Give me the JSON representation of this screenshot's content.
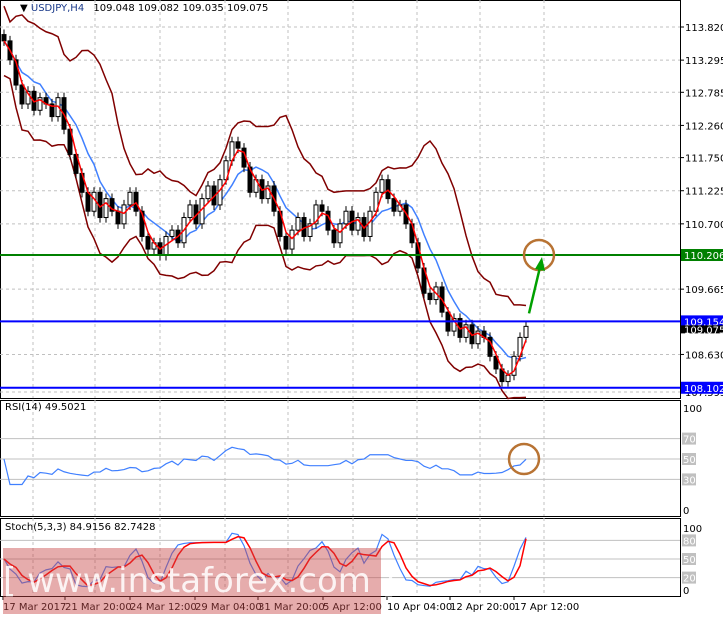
{
  "header": {
    "symbol": "USDJPY,H4",
    "ohlc": "109.048 109.082 109.035 109.075"
  },
  "rsi_label": "RSI(14) 49.5021",
  "stoch_label": "Stoch(5,3,3) 84.9156 82.7428",
  "watermark": "[ www.instaforex.com ]",
  "colors": {
    "bollinger": "#800000",
    "ma_fast": "#ff0000",
    "ma_slow": "#4080ff",
    "support": "#0000ff",
    "resistance": "#008000",
    "annotation": "#b87333",
    "arrow": "#00a000"
  },
  "chart_data": {
    "type": "candlestick",
    "price_ticks": [
      "113.820",
      "113.295",
      "112.785",
      "112.260",
      "111.750",
      "111.225",
      "110.700",
      "109.665",
      "108.630",
      "107.595"
    ],
    "price_range": [
      107.6,
      114.2
    ],
    "levels": [
      {
        "value": "110.206",
        "kind": "resistance"
      },
      {
        "value": "109.154",
        "kind": "support"
      },
      {
        "value": "108.102",
        "kind": "support"
      }
    ],
    "current_price": "109.075",
    "x_labels": [
      "17 Mar 2017",
      "21 Mar 20:00",
      "24 Mar 12:00",
      "29 Mar 04:00",
      "31 Mar 20:00",
      "5 Apr 12:00",
      "10 Apr 04:00",
      "12 Apr 20:00",
      "17 Apr 12:00"
    ],
    "closes": [
      113.6,
      113.3,
      112.9,
      112.6,
      112.8,
      112.5,
      112.7,
      112.6,
      112.4,
      112.7,
      112.2,
      111.8,
      111.5,
      111.2,
      110.9,
      111.2,
      110.8,
      111.1,
      110.9,
      110.7,
      111.0,
      111.2,
      110.9,
      110.5,
      110.3,
      110.4,
      110.2,
      110.5,
      110.6,
      110.4,
      110.8,
      111.0,
      110.7,
      111.1,
      111.3,
      111.0,
      111.4,
      111.7,
      112.0,
      111.9,
      111.6,
      111.2,
      111.4,
      111.1,
      111.3,
      110.9,
      110.5,
      110.3,
      110.6,
      110.8,
      110.5,
      110.7,
      111.0,
      110.9,
      110.6,
      110.4,
      110.7,
      110.9,
      110.6,
      110.8,
      110.5,
      110.9,
      111.2,
      111.4,
      111.1,
      110.9,
      111.0,
      110.7,
      110.4,
      110.0,
      109.6,
      109.5,
      109.7,
      109.3,
      109.0,
      109.2,
      108.9,
      109.1,
      108.8,
      109.0,
      108.9,
      108.6,
      108.4,
      108.2,
      108.3,
      108.6,
      108.9,
      109.075
    ],
    "rsi": {
      "levels": [
        70,
        50,
        30
      ],
      "range": [
        0,
        100
      ],
      "ticks": [
        "100",
        "70",
        "50",
        "30",
        "0"
      ],
      "value": 49.5
    },
    "stoch": {
      "levels": [
        80,
        50,
        20
      ],
      "range": [
        0,
        100
      ],
      "ticks": [
        "100",
        "80",
        "50",
        "20",
        "0"
      ],
      "k": 84.92,
      "d": 82.74
    }
  },
  "annotations": [
    {
      "kind": "circle",
      "at": "110.206"
    },
    {
      "kind": "circle",
      "at": "RSI 50"
    },
    {
      "kind": "arrow-up",
      "from": "109.154",
      "to": "110.206"
    }
  ]
}
